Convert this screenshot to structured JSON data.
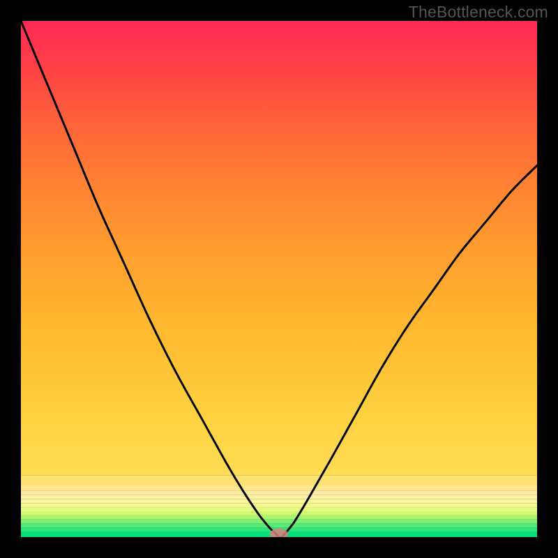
{
  "watermark": "TheBottleneck.com",
  "chart_data": {
    "type": "line",
    "title": "",
    "xlabel": "",
    "ylabel": "",
    "xlim": [
      0,
      100
    ],
    "ylim": [
      0,
      100
    ],
    "legend": false,
    "grid": false,
    "series": [
      {
        "name": "curve",
        "x": [
          0,
          5,
          10,
          15,
          20,
          25,
          30,
          35,
          40,
          43,
          46,
          48,
          49,
          49.5,
          50,
          50.5,
          51,
          53,
          56,
          60,
          65,
          70,
          75,
          80,
          85,
          90,
          95,
          100
        ],
        "y": [
          100,
          88,
          76,
          64,
          53,
          42,
          32,
          23,
          14,
          9,
          4.5,
          2,
          1,
          0.5,
          0,
          0,
          0.5,
          3,
          8,
          15,
          24,
          33,
          41,
          48,
          55,
          61,
          67,
          72
        ],
        "color": "#000000",
        "linewidth": 3
      }
    ],
    "marker": {
      "name": "vertex-marker",
      "cx": 50,
      "cy": 0.5,
      "rx": 1.8,
      "ry": 1.2,
      "fill": "#d9817c",
      "opacity": 0.85
    },
    "bottom_bands": [
      {
        "y0": 0.0,
        "y1": 1.0,
        "color": "#03e07c"
      },
      {
        "y0": 1.0,
        "y1": 1.8,
        "color": "#2de67a"
      },
      {
        "y0": 1.8,
        "y1": 2.6,
        "color": "#55eb78"
      },
      {
        "y0": 2.6,
        "y1": 3.4,
        "color": "#7df176"
      },
      {
        "y0": 3.4,
        "y1": 4.2,
        "color": "#a6f674"
      },
      {
        "y0": 4.2,
        "y1": 5.0,
        "color": "#cefb73"
      },
      {
        "y0": 5.0,
        "y1": 5.8,
        "color": "#e7fc80"
      },
      {
        "y0": 5.8,
        "y1": 6.6,
        "color": "#f4fa8f"
      },
      {
        "y0": 6.6,
        "y1": 7.4,
        "color": "#fdf79e"
      },
      {
        "y0": 7.4,
        "y1": 8.2,
        "color": "#fff2a7"
      },
      {
        "y0": 8.2,
        "y1": 9.0,
        "color": "#ffeca5"
      },
      {
        "y0": 9.0,
        "y1": 10.0,
        "color": "#ffe78f"
      },
      {
        "y0": 10.0,
        "y1": 12.0,
        "color": "#ffe174"
      }
    ],
    "main_gradient": {
      "y0": 12.0,
      "y1": 100.0,
      "stops": [
        {
          "offset": 0.0,
          "color": "#ffdd55"
        },
        {
          "offset": 0.15,
          "color": "#ffcf3e"
        },
        {
          "offset": 0.35,
          "color": "#ffb52f"
        },
        {
          "offset": 0.55,
          "color": "#ff9430"
        },
        {
          "offset": 0.75,
          "color": "#ff6a38"
        },
        {
          "offset": 0.9,
          "color": "#ff4045"
        },
        {
          "offset": 1.0,
          "color": "#ff2a56"
        }
      ]
    }
  }
}
